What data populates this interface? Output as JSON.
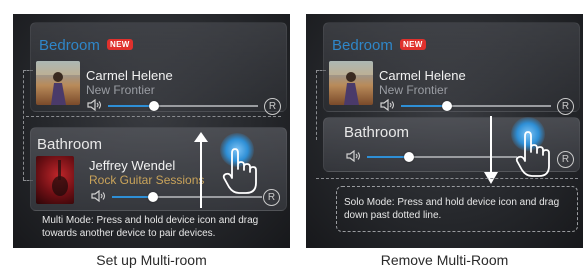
{
  "left": {
    "top_card": {
      "room": "Bedroom",
      "badge": "NEW",
      "artist": "Carmel Helene",
      "album": "New Frontier",
      "volume": 0.45,
      "button": "R"
    },
    "bottom_card": {
      "room": "Bathroom",
      "artist": "Jeffrey Wendel",
      "album": "Rock Guitar Sessions",
      "volume": 0.3,
      "button": "R"
    },
    "hint": "Multi Mode: Press and hold device icon and drag towards another device to pair devices.",
    "caption": "Set up Multi-room"
  },
  "right": {
    "top_card": {
      "room": "Bedroom",
      "badge": "NEW",
      "artist": "Carmel Helene",
      "album": "New Frontier",
      "volume": 0.45,
      "button": "R"
    },
    "bottom_card": {
      "room": "Bathroom",
      "volume": 0.3,
      "button": "R"
    },
    "hint": "Solo Mode: Press and hold device icon and drag down past dotted line.",
    "caption": "Remove Multi-Room"
  },
  "colors": {
    "accent": "#2e8fd6",
    "badge": "#e0312d",
    "album": "#c9a35a"
  }
}
